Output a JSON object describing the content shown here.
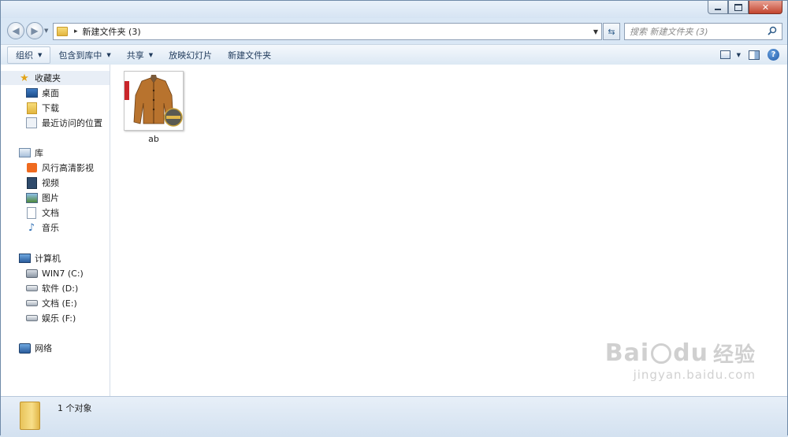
{
  "address": {
    "crumb_arrow": "▸",
    "path": "新建文件夹 (3)",
    "refresh_icon": "refresh-icon"
  },
  "search": {
    "placeholder": "搜索 新建文件夹 (3)"
  },
  "toolbar": {
    "organize": "组织",
    "include_in_library": "包含到库中",
    "share": "共享",
    "slideshow": "放映幻灯片",
    "new_folder": "新建文件夹"
  },
  "nav": {
    "favorites": {
      "label": "收藏夹",
      "items": [
        "桌面",
        "下载",
        "最近访问的位置"
      ]
    },
    "libraries": {
      "label": "库",
      "items": [
        "风行高清影视",
        "视频",
        "图片",
        "文档",
        "音乐"
      ]
    },
    "computer": {
      "label": "计算机",
      "items": [
        "WIN7 (C:)",
        "软件 (D:)",
        "文档 (E:)",
        "娱乐 (F:)"
      ]
    },
    "network": {
      "label": "网络"
    }
  },
  "files": [
    {
      "name": "ab"
    }
  ],
  "status": {
    "text": "1 个对象"
  },
  "watermark": {
    "brand": "Bai",
    "brand2": "du",
    "suffix": "经验",
    "url": "jingyan.baidu.com"
  },
  "colors": {
    "accent": "#1e395b",
    "selection": "#e8eef6"
  }
}
